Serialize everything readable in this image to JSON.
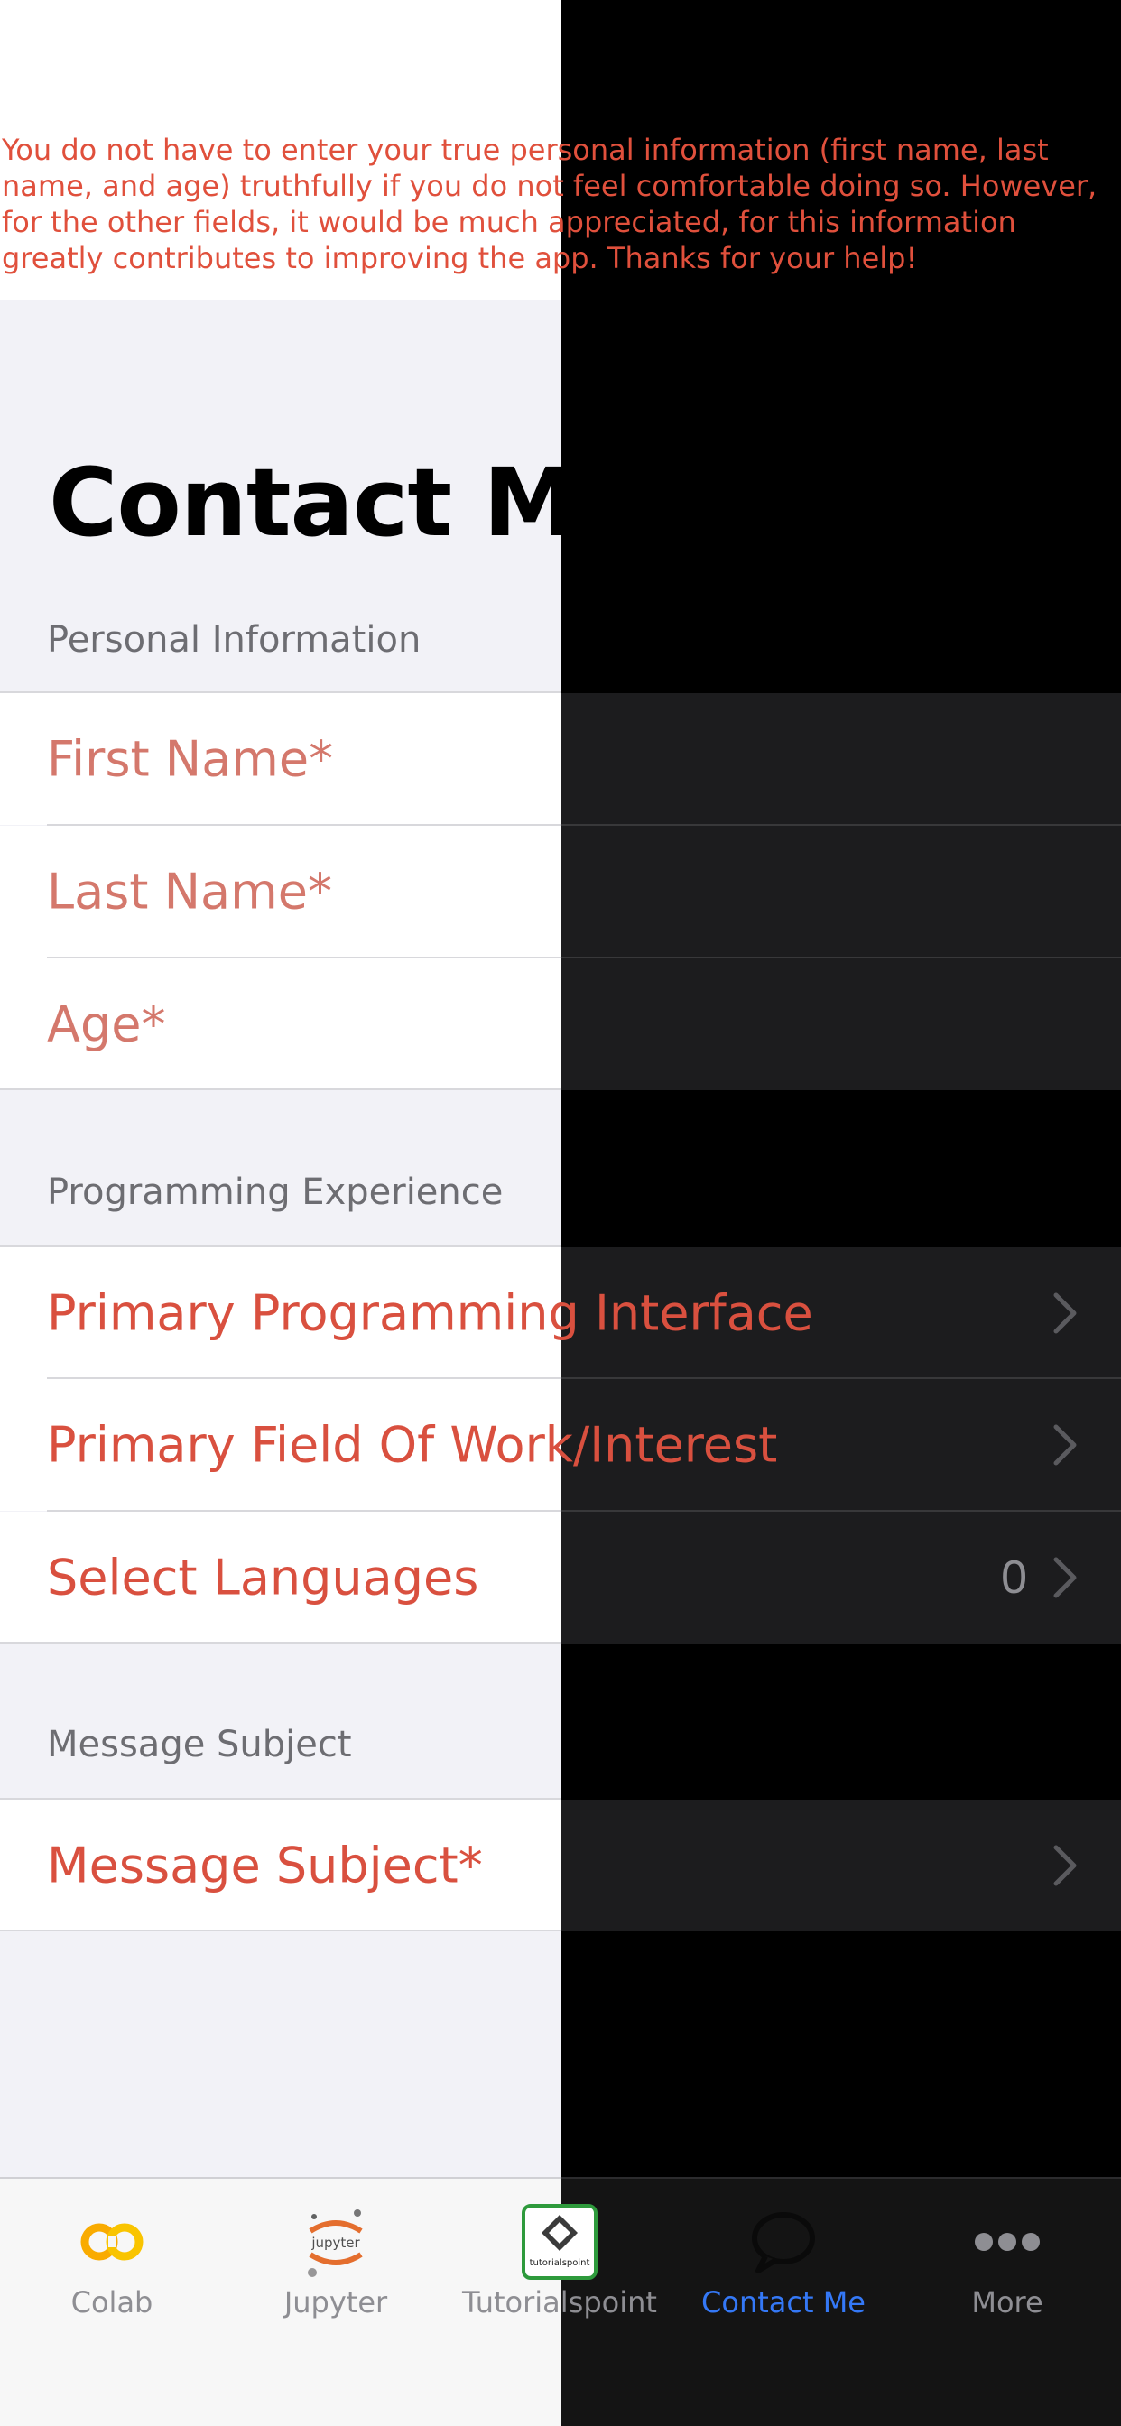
{
  "notice_text": "You do not have to enter your true personal information (first name, last name, and age) truthfully if you do not feel comfortable doing so. However, for the other fields, it would be much appreciated, for this information greatly contributes to improving the app. Thanks for your help!",
  "page_title": "Contact Me",
  "sections": {
    "personal": {
      "header": "Personal Information",
      "first_name_placeholder": "First Name*",
      "last_name_placeholder": "Last Name*",
      "age_placeholder": "Age*"
    },
    "programming": {
      "header": "Programming Experience",
      "interface_label": "Primary Programming Interface",
      "field_label": "Primary Field Of Work/Interest",
      "languages_label": "Select Languages",
      "languages_count": "0"
    },
    "message": {
      "header": "Message Subject",
      "subject_label": "Message Subject*"
    }
  },
  "tabbar": {
    "tabs": [
      {
        "label": "Colab",
        "icon": "colab-icon",
        "active": false
      },
      {
        "label": "Jupyter",
        "icon": "jupyter-icon",
        "active": false
      },
      {
        "label": "Tutorialspoint",
        "icon": "tutorialspoint-icon",
        "active": false
      },
      {
        "label": "Contact Me",
        "icon": "speech-bubble-icon",
        "active": true
      },
      {
        "label": "More",
        "icon": "ellipsis-icon",
        "active": false
      }
    ],
    "jupyter_logo_text": "jupyter",
    "tutorialspoint_logo_text": "tutorialspoint"
  },
  "colors": {
    "accent_red": "#d9503f",
    "active_tab_blue": "#3478f6",
    "colab_orange": "#f9ab00"
  }
}
